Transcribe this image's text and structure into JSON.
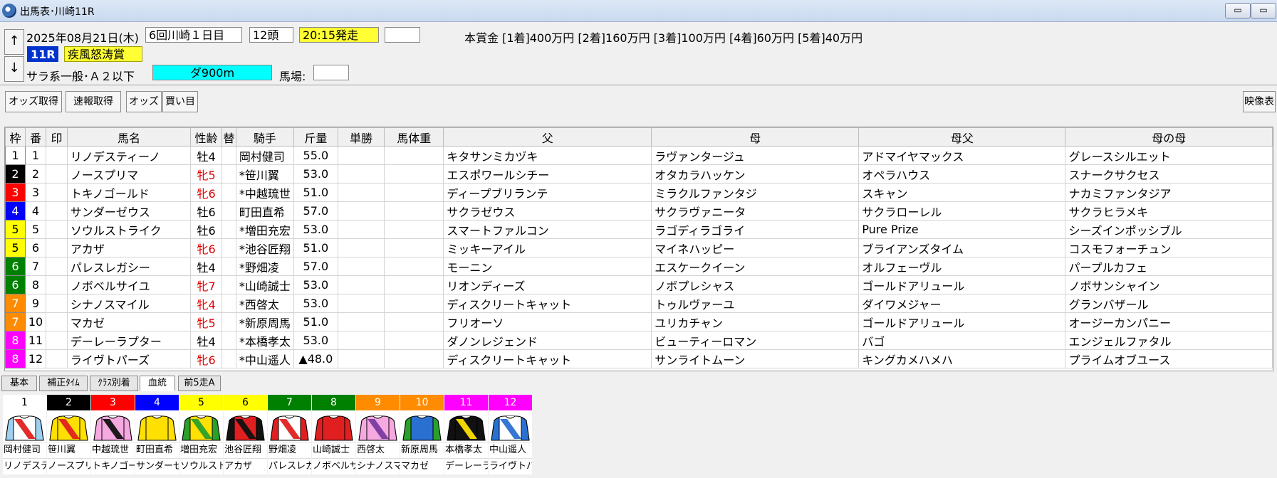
{
  "window": {
    "title": "出馬表･川崎11R",
    "min_label": "▭",
    "max_label": "▭"
  },
  "header": {
    "date": "2025年08月21日(木)",
    "meeting": "6回川崎１日目",
    "heads": "12頭",
    "post_time": "20:15発走",
    "race_no": "11R",
    "race_name": "疾風怒涛賞",
    "race_class": "サラ系一般･Ａ２以下",
    "course": "ダ900m",
    "baba_label": "馬場:",
    "prize": "本賞金 [1着]400万円 [2着]160万円 [3着]100万円 [4着]60万円 [5着]40万円",
    "up_arrow": "↑",
    "down_arrow": "↓"
  },
  "toolbar": {
    "odds_fetch": "オッズ取得",
    "sokuho": "速報取得",
    "odds": "オッズ",
    "kaime": "買い目",
    "video": "映像表"
  },
  "columns": [
    "枠",
    "番",
    "印",
    "馬名",
    "性齢",
    "替",
    "騎手",
    "斤量",
    "単勝",
    "馬体重",
    "父",
    "母",
    "母父",
    "母の母"
  ],
  "waku_colors": {
    "1": "#ffffff",
    "2": "#000000",
    "3": "#ff0000",
    "4": "#0000ff",
    "5": "#ffff00",
    "6": "#008000",
    "7": "#ff8c00",
    "8": "#ff00ff"
  },
  "rows": [
    {
      "waku": "1",
      "num": "1",
      "horse": "リノデスティーノ",
      "sexage": "牡4",
      "mare": false,
      "change": "",
      "jockey": "岡村健司",
      "weight": "55.0",
      "sire": "キタサンミカヅキ",
      "dam": "ラヴァンタージュ",
      "damsire": "アドマイヤマックス",
      "granddam": "グレースシルエット"
    },
    {
      "waku": "2",
      "num": "2",
      "horse": "ノースプリマ",
      "sexage": "牝5",
      "mare": true,
      "change": "",
      "jockey": "*笹川翼",
      "weight": "53.0",
      "sire": "エスポワールシチー",
      "dam": "オタカラハッケン",
      "damsire": "オペラハウス",
      "granddam": "スナークサクセス"
    },
    {
      "waku": "3",
      "num": "3",
      "horse": "トキノゴールド",
      "sexage": "牝6",
      "mare": true,
      "change": "",
      "jockey": "*中越琉世",
      "weight": "51.0",
      "sire": "ディープブリランテ",
      "dam": "ミラクルファンタジ",
      "damsire": "スキャン",
      "granddam": "ナカミファンタジア"
    },
    {
      "waku": "4",
      "num": "4",
      "horse": "サンダーゼウス",
      "sexage": "牡6",
      "mare": false,
      "change": "",
      "jockey": "町田直希",
      "weight": "57.0",
      "sire": "サクラゼウス",
      "dam": "サクラヴァニータ",
      "damsire": "サクラローレル",
      "granddam": "サクラヒラメキ"
    },
    {
      "waku": "5",
      "num": "5",
      "horse": "ソウルストライク",
      "sexage": "牡6",
      "mare": false,
      "change": "",
      "jockey": "*増田充宏",
      "weight": "53.0",
      "sire": "スマートファルコン",
      "dam": "ラゴディラゴライ",
      "damsire": "Pure Prize",
      "granddam": "シーズインポッシブル"
    },
    {
      "waku": "5",
      "num": "6",
      "horse": "アカザ",
      "sexage": "牝6",
      "mare": true,
      "change": "",
      "jockey": "*池谷匠翔",
      "weight": "51.0",
      "sire": "ミッキーアイル",
      "dam": "マイネハッピー",
      "damsire": "ブライアンズタイム",
      "granddam": "コスモフォーチュン"
    },
    {
      "waku": "6",
      "num": "7",
      "horse": "パレスレガシー",
      "sexage": "牡4",
      "mare": false,
      "change": "",
      "jockey": "*野畑凌",
      "weight": "57.0",
      "sire": "モーニン",
      "dam": "エスケークイーン",
      "damsire": "オルフェーヴル",
      "granddam": "パープルカフェ"
    },
    {
      "waku": "6",
      "num": "8",
      "horse": "ノボベルサイユ",
      "sexage": "牝7",
      "mare": true,
      "change": "",
      "jockey": "*山崎誠士",
      "weight": "53.0",
      "sire": "リオンディーズ",
      "dam": "ノボプレシャス",
      "damsire": "ゴールドアリュール",
      "granddam": "ノボサンシャイン"
    },
    {
      "waku": "7",
      "num": "9",
      "horse": "シナノスマイル",
      "sexage": "牝4",
      "mare": true,
      "change": "",
      "jockey": "*西啓太",
      "weight": "53.0",
      "sire": "ディスクリートキャット",
      "dam": "トゥルヴァーユ",
      "damsire": "ダイワメジャー",
      "granddam": "グランバザール"
    },
    {
      "waku": "7",
      "num": "10",
      "horse": "マカゼ",
      "sexage": "牝5",
      "mare": true,
      "change": "",
      "jockey": "*新原周馬",
      "weight": "51.0",
      "sire": "フリオーソ",
      "dam": "ユリカチャン",
      "damsire": "ゴールドアリュール",
      "granddam": "オージーカンパニー"
    },
    {
      "waku": "8",
      "num": "11",
      "horse": "デーレーラプター",
      "sexage": "牡4",
      "mare": false,
      "change": "",
      "jockey": "*本橋孝太",
      "weight": "53.0",
      "sire": "ダノンレジェンド",
      "dam": "ビューティーロマン",
      "damsire": "バゴ",
      "granddam": "エンジェルファタル"
    },
    {
      "waku": "8",
      "num": "12",
      "horse": "ライヴトパーズ",
      "sexage": "牝6",
      "mare": true,
      "change": "",
      "jockey": "*中山遥人",
      "weight": "▲48.0",
      "sire": "ディスクリートキャット",
      "dam": "サンライトムーン",
      "damsire": "キングカメハメハ",
      "granddam": "プライムオブユース"
    }
  ],
  "tabs": [
    "基本",
    "補正ﾀｲﾑ",
    "ｸﾗｽ別着",
    "血統",
    "前5走A"
  ],
  "active_tab": "血統",
  "silks": [
    {
      "num": "1",
      "jockey": "岡村健司",
      "horse": "リノデスティーノ",
      "body": "#ffffff",
      "sleeve": "#9fd0f0",
      "band": "#e02020"
    },
    {
      "num": "2",
      "jockey": "笹川翼",
      "horse": "ノースプリマ",
      "body": "#ffe000",
      "sleeve": "#ffe000",
      "band": "#e02020"
    },
    {
      "num": "3",
      "jockey": "中越琉世",
      "horse": "トキノゴールド",
      "body": "#f6a8e0",
      "sleeve": "#f6a8e0",
      "band": "#111111"
    },
    {
      "num": "4",
      "jockey": "町田直希",
      "horse": "サンダーゼウス",
      "body": "#ffe000",
      "sleeve": "#ffe000",
      "band": "#ffe000"
    },
    {
      "num": "5",
      "jockey": "増田充宏",
      "horse": "ソウルストライク",
      "body": "#ffe000",
      "sleeve": "#2aa02a",
      "band": "#2aa02a"
    },
    {
      "num": "6",
      "jockey": "池谷匠翔",
      "horse": "アカザ",
      "body": "#e02020",
      "sleeve": "#111111",
      "band": "#111111"
    },
    {
      "num": "7",
      "jockey": "野畑凌",
      "horse": "パレスレガシー",
      "body": "#ffffff",
      "sleeve": "#e02020",
      "band": "#e02020"
    },
    {
      "num": "8",
      "jockey": "山崎誠士",
      "horse": "ノボベルサイユ",
      "body": "#e02020",
      "sleeve": "#e02020",
      "band": "#e02020"
    },
    {
      "num": "9",
      "jockey": "西啓太",
      "horse": "シナノスマイル",
      "body": "#f6a8e0",
      "sleeve": "#f6a8e0",
      "band": "#7a3aa0"
    },
    {
      "num": "10",
      "jockey": "新原周馬",
      "horse": "マカゼ",
      "body": "#2a70d0",
      "sleeve": "#2aa02a",
      "band": "#2a70d0"
    },
    {
      "num": "11",
      "jockey": "本橋孝太",
      "horse": "デーレーラプター",
      "body": "#111111",
      "sleeve": "#111111",
      "band": "#ffe000"
    },
    {
      "num": "12",
      "jockey": "中山遥人",
      "horse": "ライヴトパーズ",
      "body": "#ffffff",
      "sleeve": "#2a70d0",
      "band": "#2a70d0"
    }
  ]
}
